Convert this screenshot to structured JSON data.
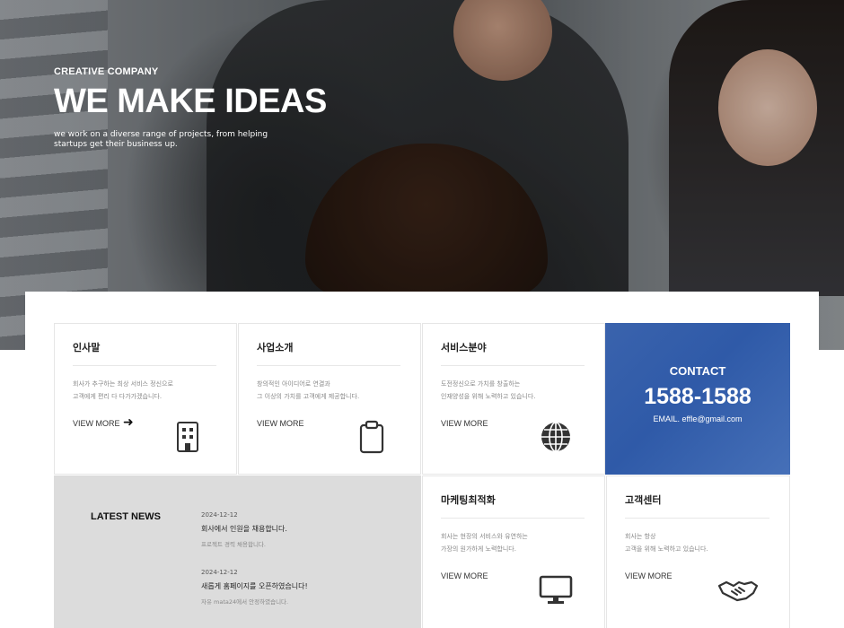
{
  "hero": {
    "subtitle": "CREATIVE COMPANY",
    "title": "WE MAKE IDEAS",
    "description": "we work on a diverse range of projects, from helping startups get their business up."
  },
  "cards": [
    {
      "title": "인사말",
      "desc1": "회사가 추구하는 최상 서비스 정신으로",
      "desc2": "고객에게 편리 다 다가가겠습니다.",
      "view_more": "VIEW MORE",
      "icon": "building-icon"
    },
    {
      "title": "사업소개",
      "desc1": "창의적인 아이디어로 연결과",
      "desc2": "그 이상의 가치를 고객에게 제공합니다.",
      "view_more": "VIEW MORE",
      "icon": "clipboard-icon"
    },
    {
      "title": "서비스분야",
      "desc1": "도전정신으로 가치를 창출하는",
      "desc2": "인재양성을 위해 노력하고 있습니다.",
      "view_more": "VIEW MORE",
      "icon": "globe-icon"
    },
    {
      "title": "마케팅최적화",
      "desc1": "회사는 현장의 서비스와 유연하는",
      "desc2": "가장의 원가하게 노력합니다.",
      "view_more": "VIEW MORE",
      "icon": "monitor-icon"
    },
    {
      "title": "고객센터",
      "desc1": "회사는 항상",
      "desc2": "고객을 위해 노력하고 있습니다.",
      "view_more": "VIEW MORE",
      "icon": "handshake-icon"
    }
  ],
  "contact": {
    "label": "CONTACT",
    "phone": "1588-1588",
    "email": "EMAIL. effle@gmail.com",
    "color": "#3a63ad"
  },
  "news": {
    "title": "LATEST NEWS",
    "items": [
      {
        "date": "2024-12-12",
        "headline": "회사에서 인원을 채용합니다.",
        "summary": "프로젝트 경력 채용합니다."
      },
      {
        "date": "2024-12-12",
        "headline": "새롭게 홈페이지를 오픈하였습니다!",
        "summary": "자유 mata24에서 안정하였습니다."
      }
    ]
  }
}
